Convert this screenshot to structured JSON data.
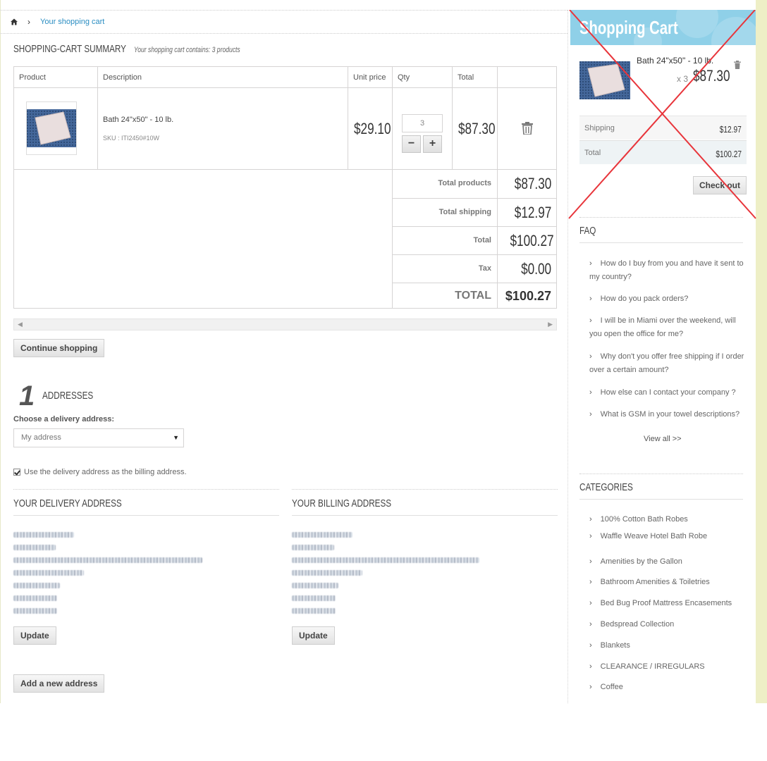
{
  "breadcrumb": {
    "current": "Your shopping cart"
  },
  "summary": {
    "title": "SHOPPING-CART SUMMARY",
    "subtitle": "Your shopping cart contains: 3 products"
  },
  "table": {
    "headers": [
      "Product",
      "Description",
      "Unit price",
      "Qty",
      "Total"
    ],
    "item": {
      "name": "Bath 24\"x50\" - 10 lb.",
      "sku": "SKU : ITI2450#10W",
      "unit_price": "$29.10",
      "qty": "3",
      "total": "$87.30"
    },
    "totals": [
      {
        "label": "Total products",
        "value": "$87.30"
      },
      {
        "label": "Total shipping",
        "value": "$12.97"
      },
      {
        "label": "Total",
        "value": "$100.27"
      },
      {
        "label": "Tax",
        "value": "$0.00"
      },
      {
        "label": "TOTAL",
        "value": "$100.27"
      }
    ]
  },
  "buttons": {
    "continue": "Continue shopping",
    "update": "Update",
    "add_address": "Add a new address",
    "checkout": "Check out"
  },
  "addresses": {
    "step": "1",
    "title": "ADDRESSES",
    "choose_label": "Choose a delivery address:",
    "selected": "My address",
    "same_billing_label": "Use the delivery address as the billing address.",
    "delivery_title": "YOUR DELIVERY ADDRESS",
    "billing_title": "YOUR BILLING ADDRESS"
  },
  "mini_cart": {
    "title": "Shopping Cart",
    "item_name": "Bath 24\"x50\" - 10 lb.",
    "item_qty": "x 3",
    "item_price": "$87.30",
    "shipping_label": "Shipping",
    "shipping_value": "$12.97",
    "total_label": "Total",
    "total_value": "$100.27"
  },
  "faq": {
    "title": "FAQ",
    "items": [
      "How do I buy from you and have it sent to my country?",
      "How do you pack orders?",
      "I will be in Miami over the weekend, will you open the office for me?",
      "Why don't you offer free shipping if I order over a certain amount?",
      "How else can I contact your company ?",
      "What is GSM in your towel descriptions?"
    ],
    "view_all": "View all >>"
  },
  "categories": {
    "title": "CATEGORIES",
    "items": [
      "100% Cotton Bath Robes",
      "Waffle Weave Hotel Bath Robe",
      "Amenities by the Gallon",
      "Bathroom Amenities & Toiletries",
      "Bed Bug Proof Mattress Encasements",
      "Bedspread Collection",
      "Blankets",
      "CLEARANCE / IRREGULARS",
      "Coffee"
    ]
  },
  "colors": {
    "link": "#2a8dc2",
    "cart_header": "#8fd0e8",
    "cross": "#e8353b"
  }
}
